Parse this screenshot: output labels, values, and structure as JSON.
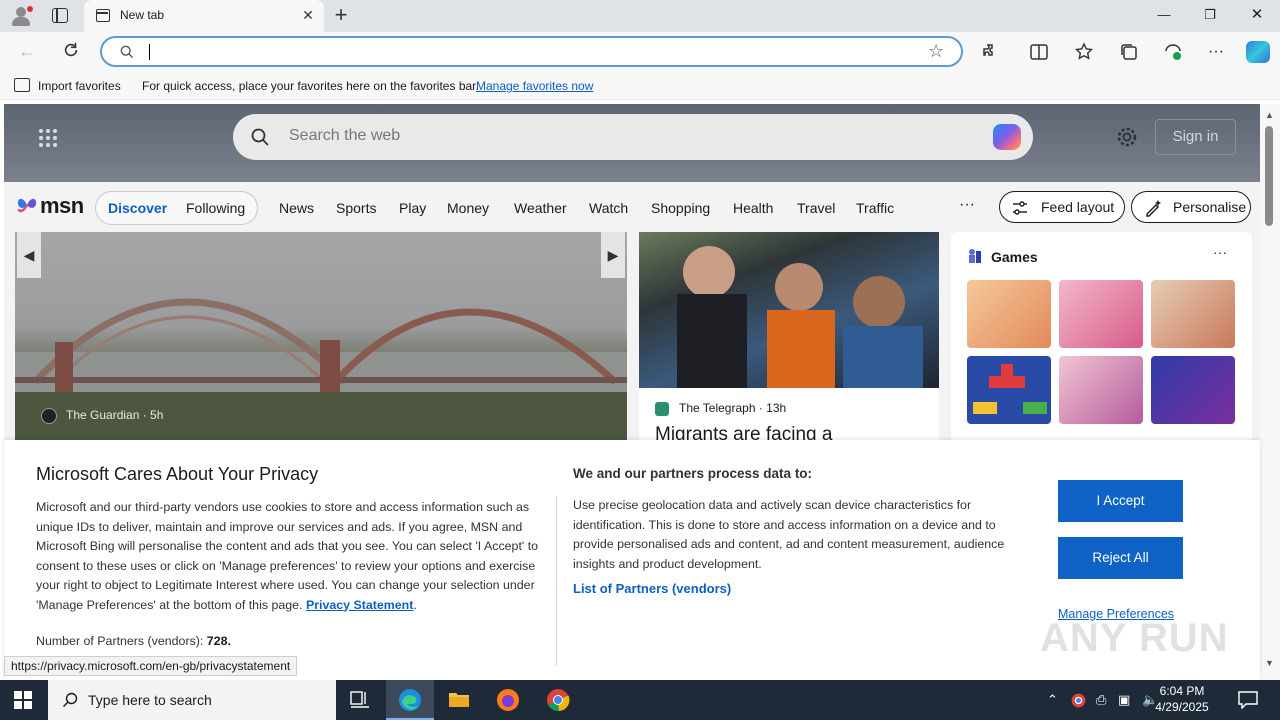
{
  "browser": {
    "tab_title": "New tab",
    "address_value": "",
    "favorites_bar": {
      "import_label": "Import favorites",
      "hint_text": "For quick access, place your favorites here on the favorites bar.",
      "manage_link": "Manage favorites now"
    }
  },
  "msn": {
    "search_placeholder": "Search the web",
    "signin_label": "Sign in",
    "logo_text": "msn",
    "pill": {
      "discover": "Discover",
      "following": "Following"
    },
    "nav_links": [
      "News",
      "Sports",
      "Play",
      "Money",
      "Weather",
      "Watch",
      "Shopping",
      "Health",
      "Travel",
      "Traffic"
    ],
    "more_label": "···",
    "feed_layout_label": "Feed layout",
    "personalise_label": "Personalise",
    "hero": {
      "source": "The Guardian · 5h"
    },
    "card2": {
      "source": "The Telegraph · 13h",
      "headline": "Migrants are facing a"
    },
    "games": {
      "title": "Games",
      "more": "···"
    }
  },
  "privacy": {
    "title": "Microsoft Cares About Your Privacy",
    "body": "Microsoft and our third-party vendors use cookies to store and access information such as unique IDs to deliver, maintain and improve our services and ads. If you agree, MSN and Microsoft Bing will personalise the content and ads that you see. You can select 'I Accept' to consent to these uses or click on 'Manage preferences' to review your options and exercise your right to object to Legitimate Interest where used.  You can change your selection under 'Manage Preferences' at the bottom of this page.",
    "privacy_link": "Privacy Statement",
    "partners_count_label": "Number of Partners (vendors):",
    "partners_count": "728.",
    "purposes_title": "We and our partners process data to:",
    "purposes_text": "Use precise geolocation data and actively scan device characteristics for identification. This is done to store and access information on a device and to provide personalised ads and content, ad and content measurement, audience insights and product development.",
    "partners_list_link": "List of Partners (vendors)",
    "accept_label": "I Accept",
    "reject_label": "Reject All",
    "manage_label": "Manage Preferences"
  },
  "status_url": "https://privacy.microsoft.com/en-gb/privacystatement",
  "watermark": "ANY RUN",
  "taskbar": {
    "search_placeholder": "Type here to search",
    "time": "6:04 PM",
    "date": "4/29/2025"
  },
  "colors": {
    "accent_blue": "#0f62c6",
    "link_blue": "#0f5ec4",
    "taskbar": "#1f2a38"
  }
}
